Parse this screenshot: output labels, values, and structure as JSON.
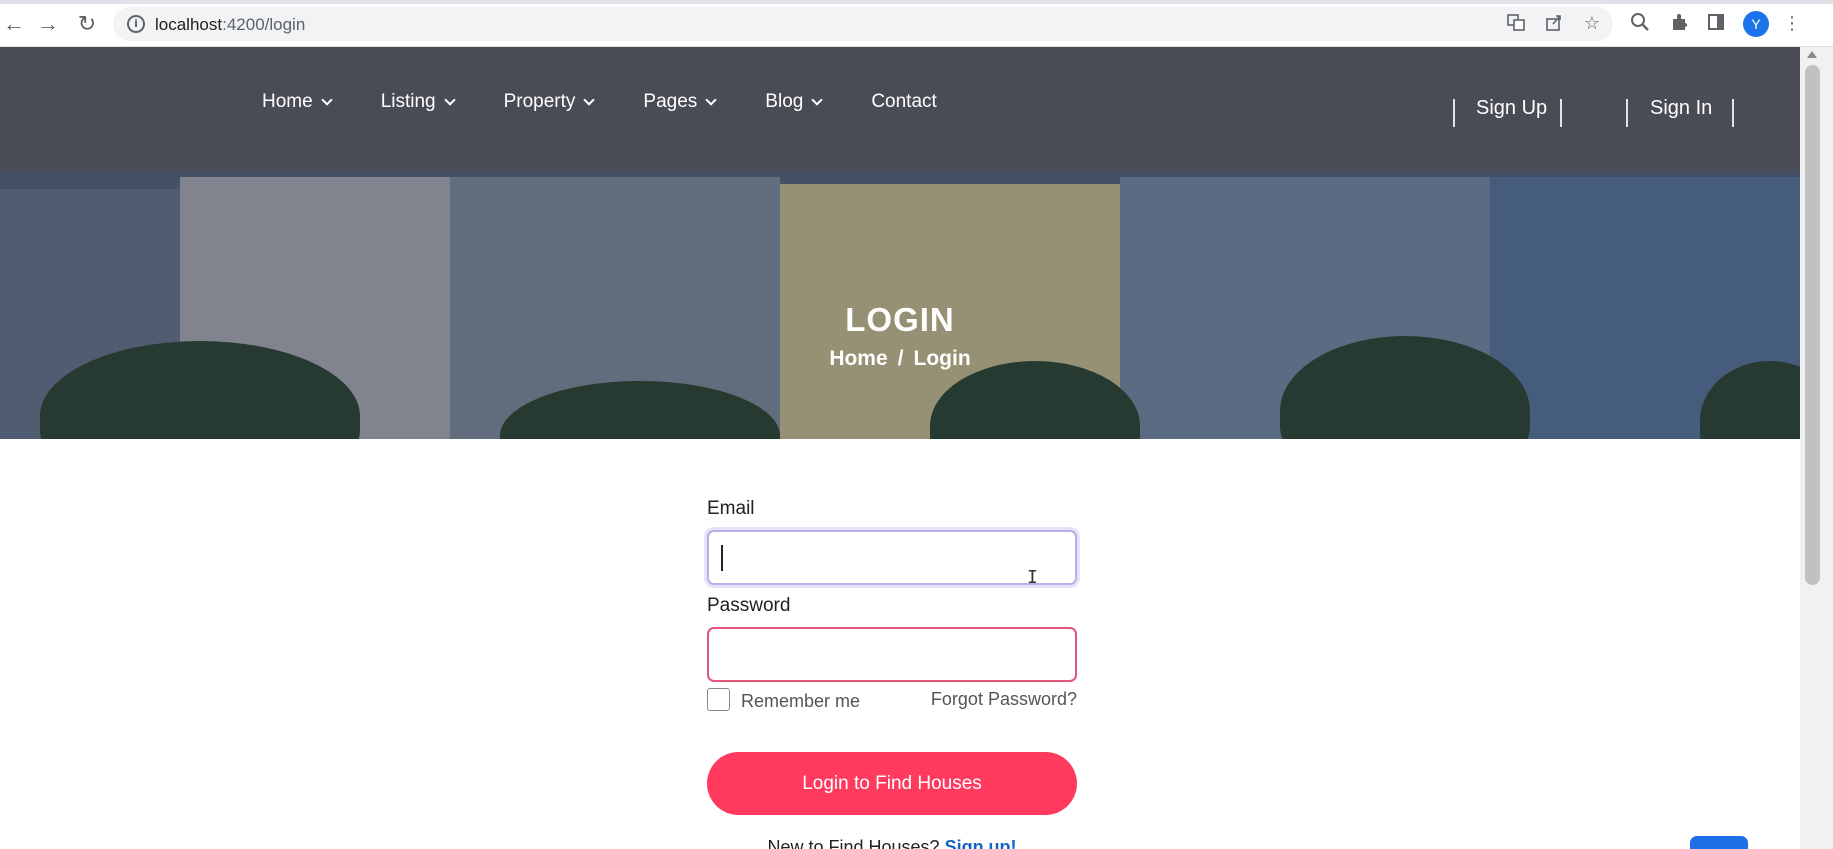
{
  "browser": {
    "url_host": "localhost",
    "url_path": ":4200/login",
    "profile_initial": "Y",
    "back_icon": "←",
    "forward_icon": "→",
    "reload_icon": "↻",
    "info_icon": "i",
    "toolbar_icons": [
      "translate-icon",
      "share-icon",
      "star-icon",
      "zoom-icon",
      "extensions-icon",
      "sidepanel-icon",
      "menu-icon"
    ]
  },
  "nav": {
    "items": [
      {
        "label": "Home",
        "has_dropdown": true
      },
      {
        "label": "Listing",
        "has_dropdown": true
      },
      {
        "label": "Property",
        "has_dropdown": true
      },
      {
        "label": "Pages",
        "has_dropdown": true
      },
      {
        "label": "Blog",
        "has_dropdown": true
      },
      {
        "label": "Contact",
        "has_dropdown": false
      }
    ],
    "sign_up": "Sign Up",
    "sign_in": "Sign In"
  },
  "hero": {
    "title": "LOGIN",
    "breadcrumb": [
      "Home",
      "/",
      "Login"
    ]
  },
  "form": {
    "email_label": "Email",
    "email_value": "",
    "password_label": "Password",
    "password_value": "",
    "remember_label": "Remember me",
    "remember_checked": false,
    "forgot_label": "Forgot Password?",
    "submit_label": "Login to Find Houses",
    "signup_prompt": "New to Find Houses?",
    "signup_link": "Sign up!"
  },
  "colors": {
    "header_bg": "#4a4c55",
    "primary_button": "#ff3a5e",
    "link": "#1565c0",
    "email_focus_border": "#b8b0e6",
    "password_invalid_border": "#e0557a"
  }
}
